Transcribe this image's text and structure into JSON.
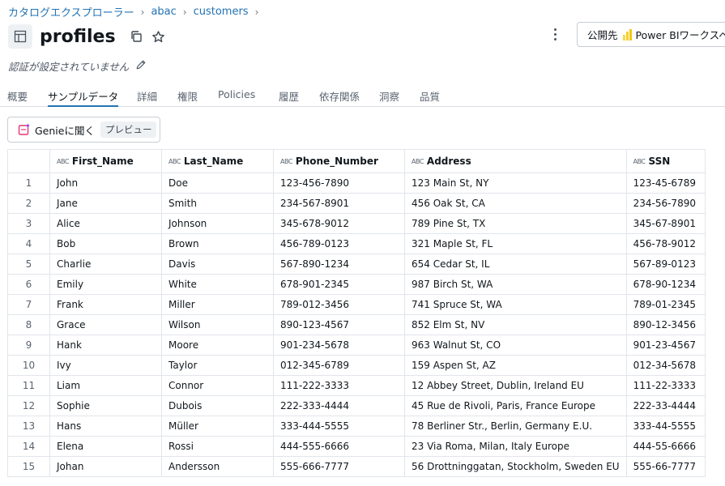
{
  "breadcrumb": {
    "items": [
      "カタログエクスプローラー",
      "abac",
      "customers"
    ],
    "separator": "›"
  },
  "header": {
    "title": "profiles",
    "publish_label": "公開先",
    "power_bi_label": "Power BIワークスペ"
  },
  "auth": {
    "text": "認証が設定されていません"
  },
  "tabs": [
    {
      "label": "概要",
      "active": false
    },
    {
      "label": "サンプルデータ",
      "active": true
    },
    {
      "label": "詳細",
      "active": false
    },
    {
      "label": "権限",
      "active": false
    },
    {
      "label": "Policies",
      "active": false
    },
    {
      "label": "履歴",
      "active": false
    },
    {
      "label": "依存関係",
      "active": false
    },
    {
      "label": "洞察",
      "active": false
    },
    {
      "label": "品質",
      "active": false
    }
  ],
  "genie": {
    "label": "Genieに聞く",
    "badge": "プレビュー"
  },
  "table": {
    "type_icon": "ABC",
    "columns": [
      "First_Name",
      "Last_Name",
      "Phone_Number",
      "Address",
      "SSN"
    ],
    "rows": [
      {
        "n": "1",
        "cells": [
          "John",
          "Doe",
          "123-456-7890",
          "123 Main St, NY",
          "123-45-6789"
        ]
      },
      {
        "n": "2",
        "cells": [
          "Jane",
          "Smith",
          "234-567-8901",
          "456 Oak St, CA",
          "234-56-7890"
        ]
      },
      {
        "n": "3",
        "cells": [
          "Alice",
          "Johnson",
          "345-678-9012",
          "789 Pine St, TX",
          "345-67-8901"
        ]
      },
      {
        "n": "4",
        "cells": [
          "Bob",
          "Brown",
          "456-789-0123",
          "321 Maple St, FL",
          "456-78-9012"
        ]
      },
      {
        "n": "5",
        "cells": [
          "Charlie",
          "Davis",
          "567-890-1234",
          "654 Cedar St, IL",
          "567-89-0123"
        ]
      },
      {
        "n": "6",
        "cells": [
          "Emily",
          "White",
          "678-901-2345",
          "987 Birch St, WA",
          "678-90-1234"
        ]
      },
      {
        "n": "7",
        "cells": [
          "Frank",
          "Miller",
          "789-012-3456",
          "741 Spruce St, WA",
          "789-01-2345"
        ]
      },
      {
        "n": "8",
        "cells": [
          "Grace",
          "Wilson",
          "890-123-4567",
          "852 Elm St, NV",
          "890-12-3456"
        ]
      },
      {
        "n": "9",
        "cells": [
          "Hank",
          "Moore",
          "901-234-5678",
          "963 Walnut St, CO",
          "901-23-4567"
        ]
      },
      {
        "n": "10",
        "cells": [
          "Ivy",
          "Taylor",
          "012-345-6789",
          "159 Aspen St, AZ",
          "012-34-5678"
        ]
      },
      {
        "n": "11",
        "cells": [
          "Liam",
          "Connor",
          "111-222-3333",
          "12 Abbey Street, Dublin, Ireland EU",
          "111-22-3333"
        ]
      },
      {
        "n": "12",
        "cells": [
          "Sophie",
          "Dubois",
          "222-333-4444",
          "45 Rue de Rivoli, Paris, France Europe",
          "222-33-4444"
        ]
      },
      {
        "n": "13",
        "cells": [
          "Hans",
          "Müller",
          "333-444-5555",
          "78 Berliner Str., Berlin, Germany E.U.",
          "333-44-5555"
        ]
      },
      {
        "n": "14",
        "cells": [
          "Elena",
          "Rossi",
          "444-555-6666",
          "23 Via Roma, Milan, Italy Europe",
          "444-55-6666"
        ]
      },
      {
        "n": "15",
        "cells": [
          "Johan",
          "Andersson",
          "555-666-7777",
          "56 Drottninggatan, Stockholm, Sweden EU",
          "555-66-7777"
        ]
      }
    ]
  },
  "colors": {
    "link": "#2272b4",
    "tab_underline": "#2272b4",
    "power_bi": "#f2c811",
    "genie_icon": "#e5356f"
  },
  "icons": {
    "table": "table-icon",
    "copy": "copy-icon",
    "star": "star-outline-icon",
    "kebab": "kebab-menu-icon",
    "pencil": "pencil-icon",
    "genie": "genie-sparkle-icon",
    "power_bi": "power-bi-logo"
  }
}
